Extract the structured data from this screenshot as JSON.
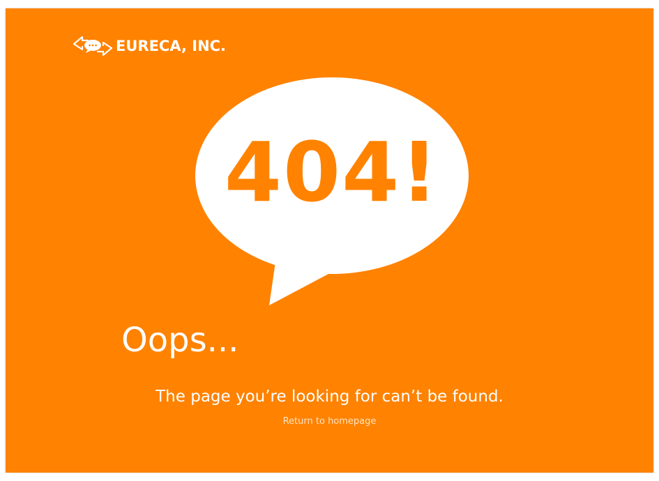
{
  "brand": {
    "logo_icon": "speech-arrows-icon",
    "name": "EURECA, INC."
  },
  "error": {
    "code_text": "404!",
    "heading": "Oops...",
    "message": "The page you’re looking for can’t be found.",
    "return_link": "Return to homepage"
  },
  "colors": {
    "background": "#ff8200",
    "bubble": "#ffffff",
    "text": "#ffffff",
    "link": "#ffe3c2"
  }
}
